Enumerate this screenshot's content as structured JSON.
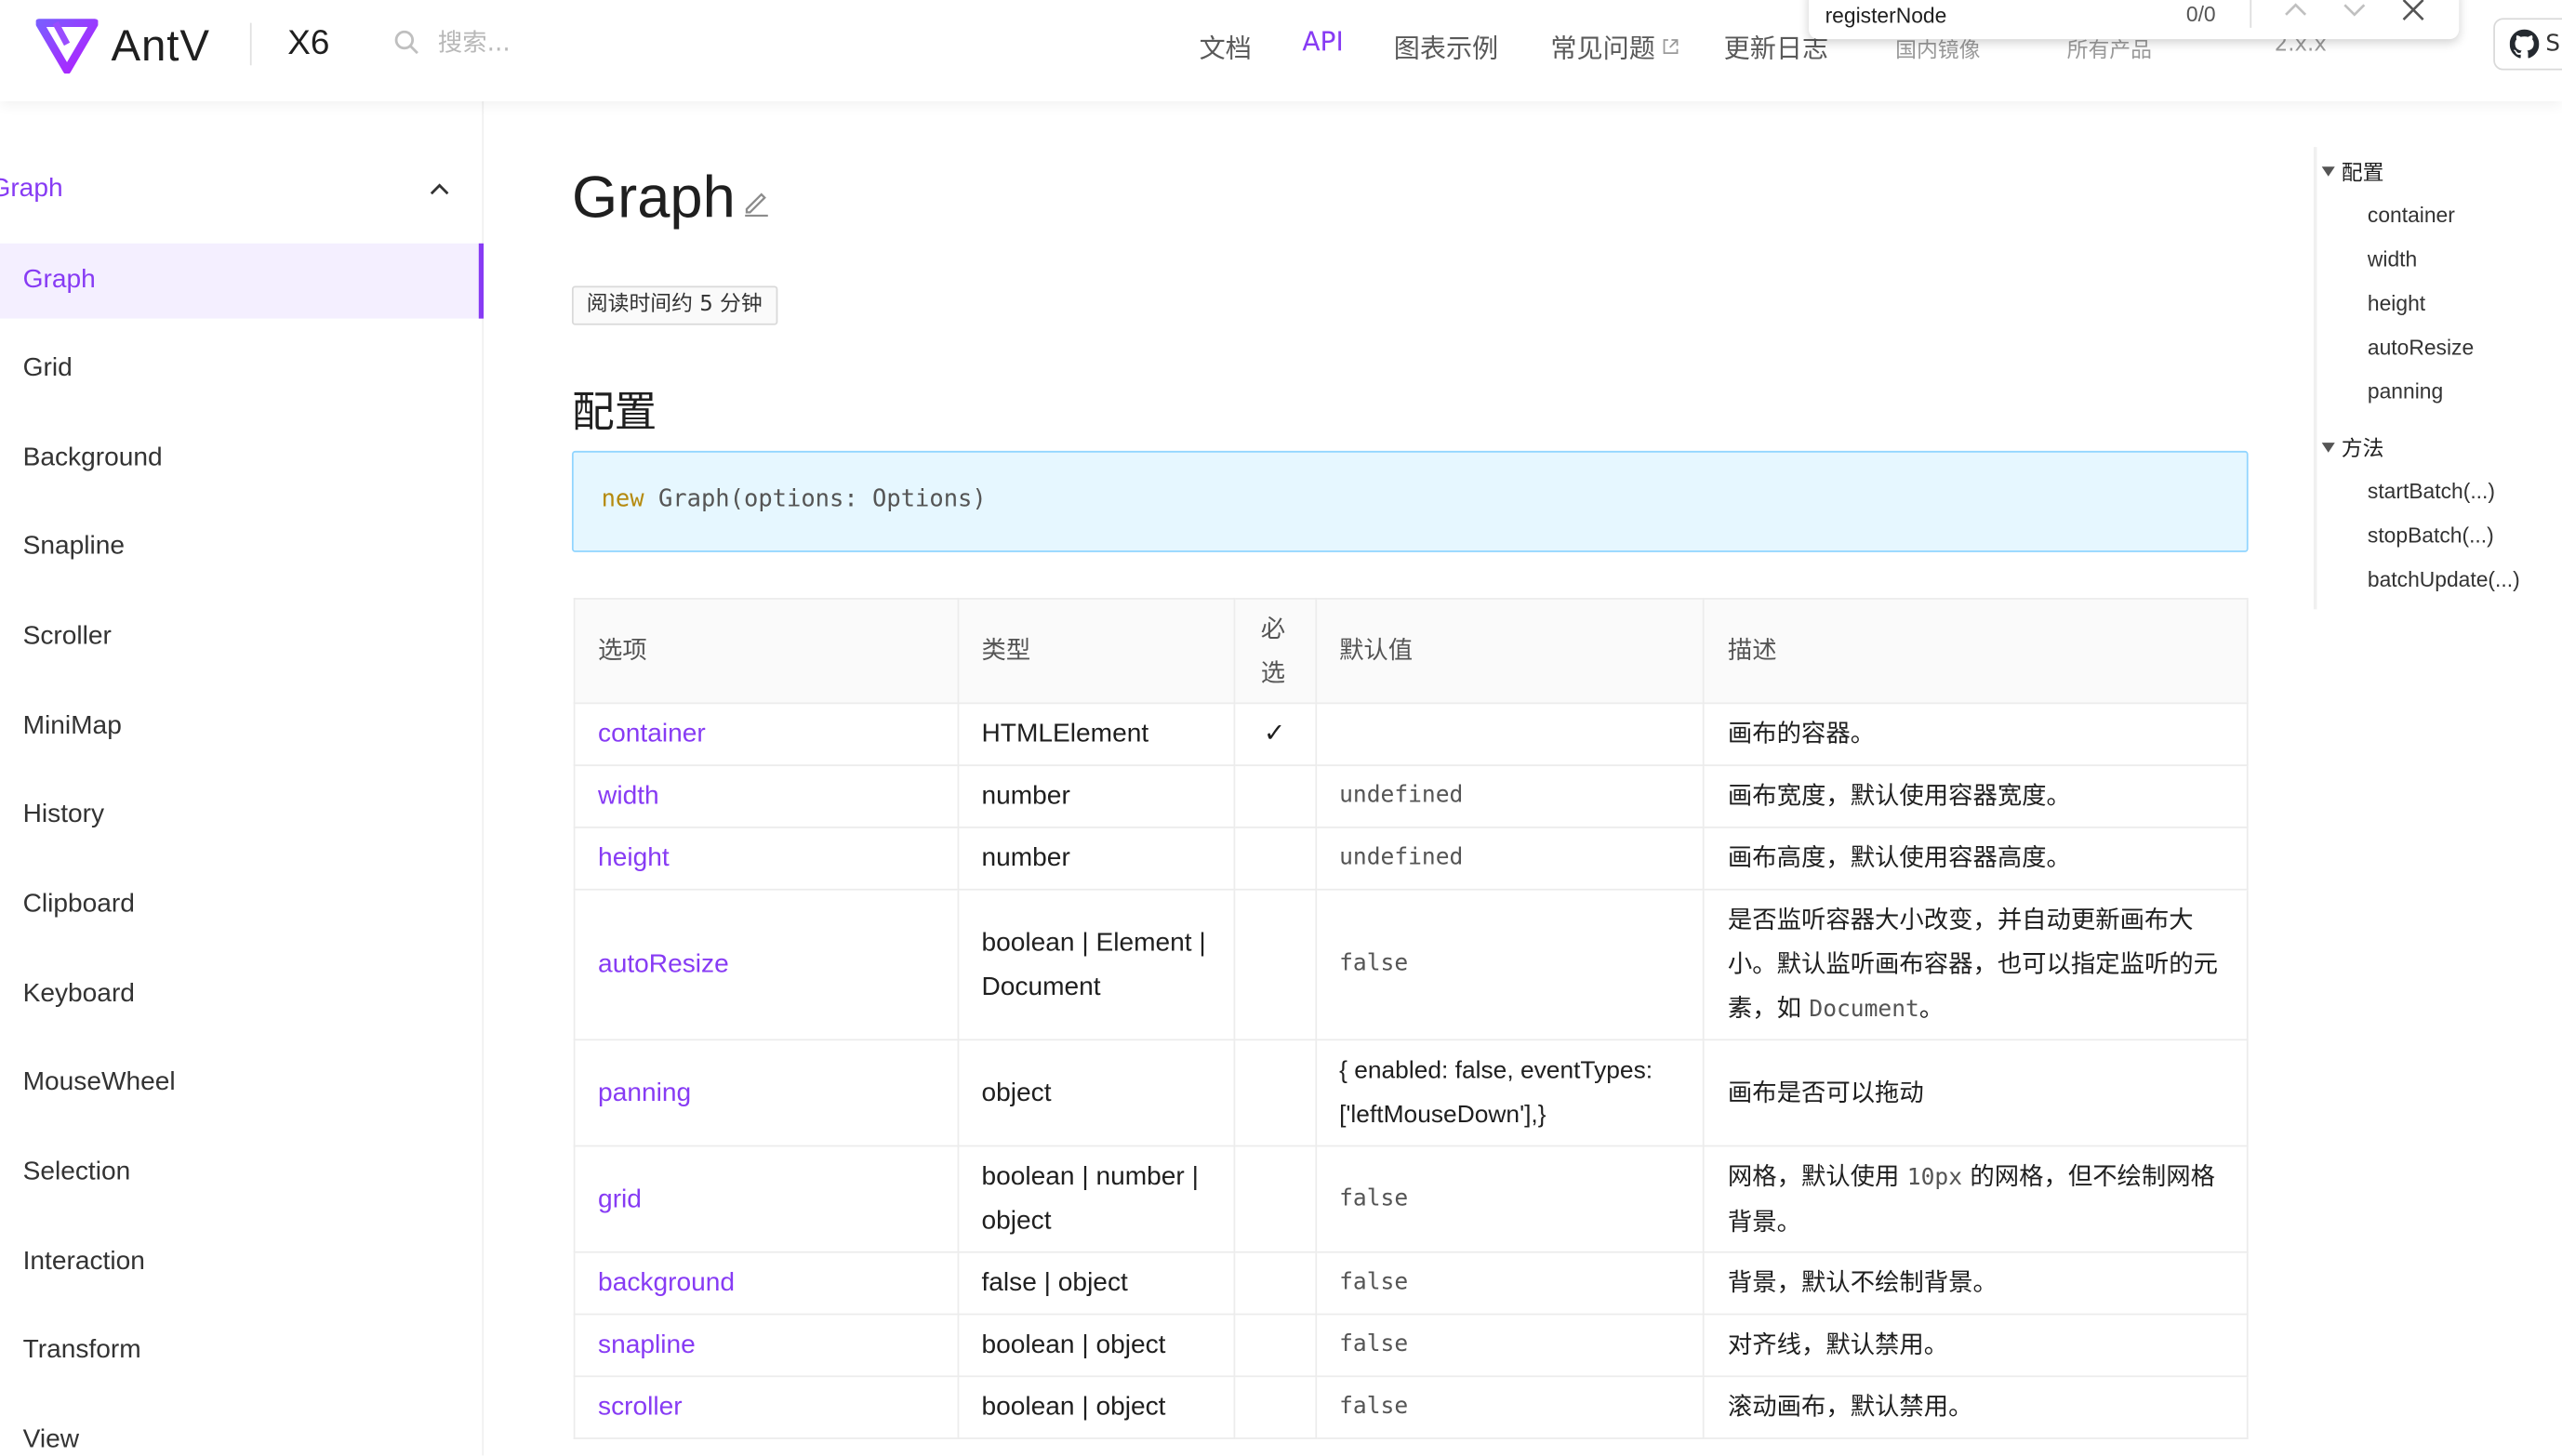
{
  "header": {
    "logo_text": "AntV",
    "product": "X6",
    "search_placeholder": "搜索...",
    "nav": [
      {
        "label": "文档"
      },
      {
        "label": "API"
      },
      {
        "label": "图表示例"
      },
      {
        "label": "常见问题"
      },
      {
        "label": "更新日志"
      }
    ],
    "obscured_nav": [
      "国内镜像",
      "所有产品",
      "2.x.x"
    ],
    "github_label": "S",
    "accent_color": "#873bf4"
  },
  "find_bar": {
    "query": "registerNode",
    "count": "0/0"
  },
  "sidebar": {
    "group": "Graph",
    "items": [
      {
        "label": "Graph"
      },
      {
        "label": "Grid"
      },
      {
        "label": "Background"
      },
      {
        "label": "Snapline"
      },
      {
        "label": "Scroller"
      },
      {
        "label": "MiniMap"
      },
      {
        "label": "History"
      },
      {
        "label": "Clipboard"
      },
      {
        "label": "Keyboard"
      },
      {
        "label": "MouseWheel"
      },
      {
        "label": "Selection"
      },
      {
        "label": "Interaction"
      },
      {
        "label": "Transform"
      },
      {
        "label": "View"
      }
    ]
  },
  "main": {
    "title": "Graph",
    "reading_time": "阅读时间约 5 分钟",
    "section_title": "配置",
    "code": {
      "keyword": "new",
      "rest": " Graph(options: Options)"
    },
    "table": {
      "headers": [
        "选项",
        "类型",
        "必选",
        "默认值",
        "描述"
      ],
      "rows": [
        {
          "option": "container",
          "type": "HTMLElement",
          "required": "✓",
          "default": "",
          "desc": "画布的容器。"
        },
        {
          "option": "width",
          "type": "number",
          "required": "",
          "default": "undefined",
          "desc": "画布宽度，默认使用容器宽度。"
        },
        {
          "option": "height",
          "type": "number",
          "required": "",
          "default": "undefined",
          "desc": "画布高度，默认使用容器高度。"
        },
        {
          "option": "autoResize",
          "type": "boolean | Element | Document",
          "required": "",
          "default": "false",
          "desc_pre": "是否监听容器大小改变，并自动更新画布大小。默认监听画布容器，也可以指定监听的元素，如 ",
          "desc_code": "Document",
          "desc_post": "。"
        },
        {
          "option": "panning",
          "type": "object",
          "required": "",
          "default": "{ enabled: false, eventTypes: ['leftMouseDown'],}",
          "desc": "画布是否可以拖动"
        },
        {
          "option": "grid",
          "type": "boolean | number | object",
          "required": "",
          "default": "false",
          "desc_pre": "网格，默认使用 ",
          "desc_code": "10px",
          "desc_post": " 的网格，但不绘制网格背景。"
        },
        {
          "option": "background",
          "type": "false | object",
          "required": "",
          "default": "false",
          "desc": "背景，默认不绘制背景。"
        },
        {
          "option": "snapline",
          "type": "boolean | object",
          "required": "",
          "default": "false",
          "desc": "对齐线，默认禁用。"
        },
        {
          "option": "scroller",
          "type": "boolean | object",
          "required": "",
          "default": "false",
          "desc": "滚动画布，默认禁用。"
        }
      ]
    }
  },
  "toc": {
    "groups": [
      {
        "label": "配置",
        "items": [
          "container",
          "width",
          "height",
          "autoResize",
          "panning"
        ]
      },
      {
        "label": "方法",
        "items": [
          "startBatch(...)",
          "stopBatch(...)",
          "batchUpdate(...)"
        ]
      }
    ]
  }
}
